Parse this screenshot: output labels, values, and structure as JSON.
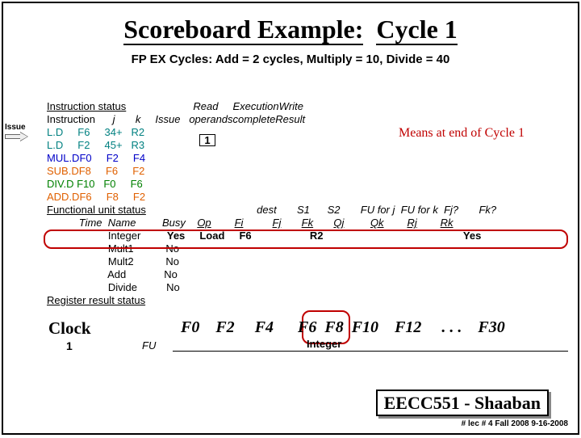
{
  "title_a": "Scoreboard Example:",
  "title_b": "Cycle 1",
  "subtitle": "FP EX Cycles:  Add = 2 cycles, Multiply = 10, Divide = 40",
  "issue_label": "Issue",
  "note": "Means at end of Cycle 1",
  "hdr": {
    "instr_status": "Instruction status",
    "read": "Read",
    "exec": "Execution",
    "write": "Write",
    "instruction": "Instruction",
    "j": "j",
    "k": "k",
    "issue": "Issue",
    "operands": "operands",
    "complete": "complete",
    "result": "Result",
    "fu_status": "Functional unit status",
    "dest": "dest",
    "s1": "S1",
    "s2": "S2",
    "fu_j": "FU for j",
    "fu_k": "FU for k",
    "fjq": "Fj?",
    "fkq": "Fk?",
    "time": "Time",
    "name": "Name",
    "busy": "Busy",
    "op": "Op",
    "fi": "Fi",
    "fj": "Fj",
    "fk": "Fk",
    "qj": "Qj",
    "qk": "Qk",
    "rj": "Rj",
    "rk": "Rk",
    "reg_status": "Register result status"
  },
  "instr": [
    {
      "op": "L.D",
      "d": "F6",
      "j": "34+",
      "k": "R2"
    },
    {
      "op": "L.D",
      "d": "F2",
      "j": "45+",
      "k": "R3"
    },
    {
      "op": "MUL.D",
      "d": "F0",
      "j": "F2",
      "k": "F4"
    },
    {
      "op": "SUB.D",
      "d": "F8",
      "j": "F6",
      "k": "F2"
    },
    {
      "op": "DIV.D",
      "d": "F10",
      "j": "F0",
      "k": "F6"
    },
    {
      "op": "ADD.D",
      "d": "F6",
      "j": "F8",
      "k": "F2"
    }
  ],
  "issue_val": "1",
  "fu": [
    {
      "name": "Integer",
      "busy": "Yes",
      "op": "Load",
      "fi": "F6",
      "fj": "",
      "fk": "R2",
      "qj": "",
      "qk": "",
      "rj": "",
      "rk": "Yes"
    },
    {
      "name": "Mult1",
      "busy": "No"
    },
    {
      "name": "Mult2",
      "busy": "No"
    },
    {
      "name": "Add",
      "busy": "No"
    },
    {
      "name": "Divide",
      "busy": "No"
    }
  ],
  "clock_label": "Clock",
  "clock_val": "1",
  "fu_label": "FU",
  "regs": {
    "f0": "F0",
    "f2": "F2",
    "f4": "F4",
    "f6": "F6",
    "f8": "F8",
    "f10": "F10",
    "f12": "F12",
    "dots": ". . .",
    "f30": "F30",
    "integer": "Integer"
  },
  "footer": "EECC551 - Shaaban",
  "footer2": "#  lec # 4  Fall 2008    9-16-2008"
}
